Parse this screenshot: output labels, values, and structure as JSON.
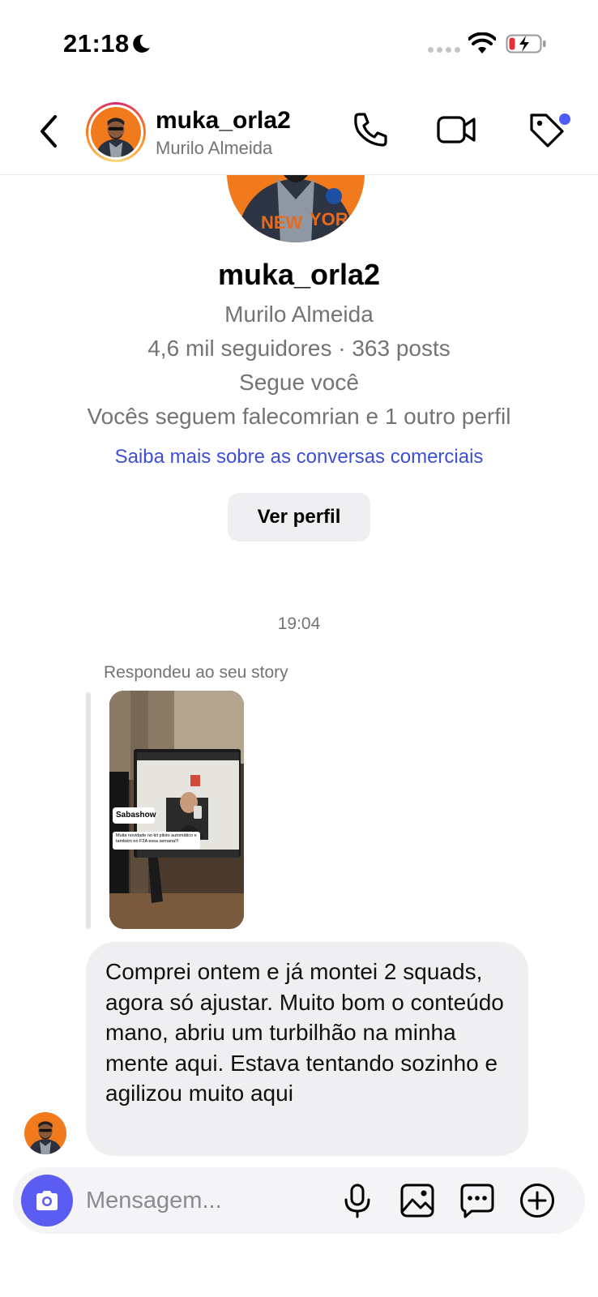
{
  "status_bar": {
    "time": "21:18"
  },
  "header": {
    "username": "muka_orla2",
    "full_name": "Murilo Almeida"
  },
  "profile": {
    "username": "muka_orla2",
    "full_name": "Murilo Almeida",
    "stats": "4,6 mil seguidores · 363 posts",
    "follows_you": "Segue você",
    "mutual": "Vocês seguem falecomrian e 1 outro perfil",
    "business_link": "Saiba mais sobre as conversas comerciais",
    "view_profile_label": "Ver perfil"
  },
  "chat": {
    "timestamp": "19:04",
    "replied_label": "Respondeu ao seu story",
    "story": {
      "name_tag": "Sabashow",
      "caption": "Muita novidade no kit piloto automático e também no F2A essa semana!!!"
    },
    "message": "Comprei ontem e já montei 2 squads, agora só ajustar. Muito bom o conteúdo mano, abriu um turbilhão na minha mente aqui. Estava tentando sozinho e agilizou muito aqui"
  },
  "composer": {
    "placeholder": "Mensagem..."
  },
  "colors": {
    "accent": "#5a5cf2",
    "link": "#3d4fd6",
    "notification_dot": "#4d5cf5",
    "bubble": "#efeff2"
  },
  "icons": [
    "moon-icon",
    "wifi-icon",
    "battery-charging-icon",
    "back-chevron-icon",
    "phone-icon",
    "video-camera-icon",
    "tag-icon",
    "camera-icon",
    "microphone-icon",
    "gallery-icon",
    "sticker-icon",
    "plus-circle-icon"
  ]
}
